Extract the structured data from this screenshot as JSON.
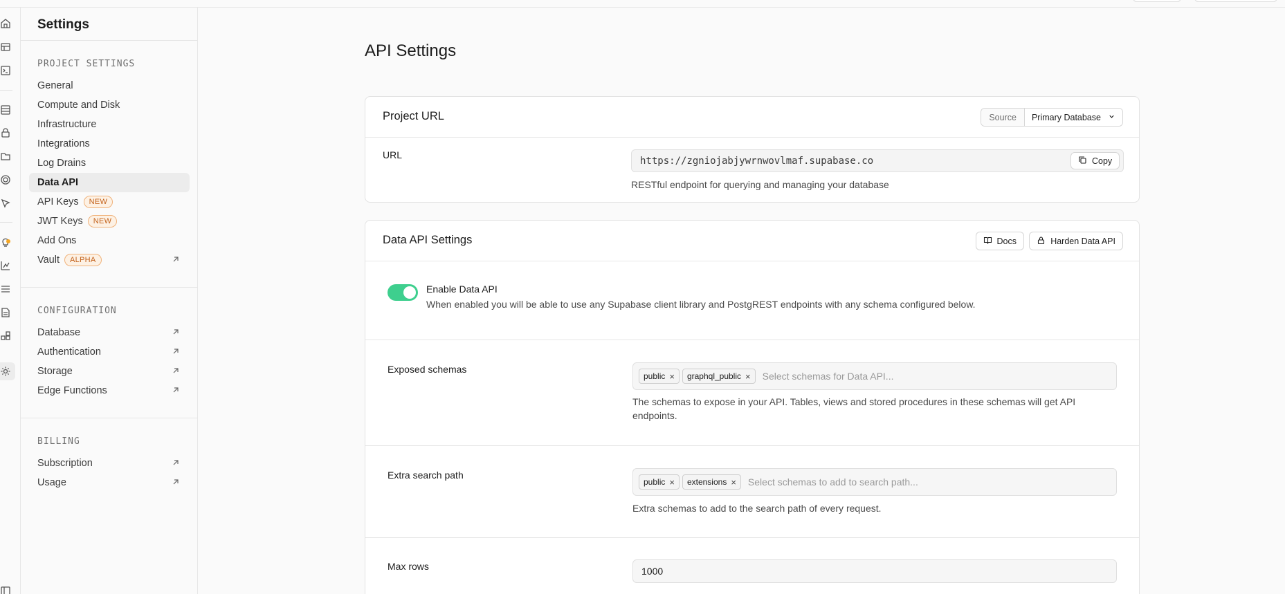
{
  "app": {
    "sidebar_title": "Settings"
  },
  "rail": {
    "icons": [
      "home-icon",
      "table-editor-icon",
      "sql-editor-icon",
      "database-icon",
      "auth-lock-icon",
      "storage-folder-icon",
      "realtime-icon",
      "edge-functions-icon",
      "advisors-bulb-icon",
      "reports-chart-icon",
      "logs-list-icon",
      "api-docs-icon",
      "integrations-icon",
      "settings-gear-icon",
      "collapse-panel-icon"
    ],
    "advisor_dot_color": "#f5a623"
  },
  "sidebar": {
    "project_settings": {
      "heading": "PROJECT SETTINGS",
      "items": [
        {
          "label": "General"
        },
        {
          "label": "Compute and Disk"
        },
        {
          "label": "Infrastructure"
        },
        {
          "label": "Integrations"
        },
        {
          "label": "Log Drains"
        },
        {
          "label": "Data API",
          "active": true
        },
        {
          "label": "API Keys",
          "badge": "NEW"
        },
        {
          "label": "JWT Keys",
          "badge": "NEW"
        },
        {
          "label": "Add Ons"
        },
        {
          "label": "Vault",
          "badge": "ALPHA",
          "external": true
        }
      ]
    },
    "configuration": {
      "heading": "CONFIGURATION",
      "items": [
        {
          "label": "Database",
          "external": true
        },
        {
          "label": "Authentication",
          "external": true
        },
        {
          "label": "Storage",
          "external": true
        },
        {
          "label": "Edge Functions",
          "external": true
        }
      ]
    },
    "billing": {
      "heading": "BILLING",
      "items": [
        {
          "label": "Subscription",
          "external": true
        },
        {
          "label": "Usage",
          "external": true
        }
      ]
    }
  },
  "main": {
    "title": "API Settings",
    "project_url": {
      "title": "Project URL",
      "source_label": "Source",
      "source_value": "Primary Database",
      "url_label": "URL",
      "url_value": "https://zgniojabjywrnwovlmaf.supabase.co",
      "copy_label": "Copy",
      "url_help": "RESTful endpoint for querying and managing your database"
    },
    "data_api": {
      "title": "Data API Settings",
      "docs_label": "Docs",
      "harden_label": "Harden Data API",
      "enable_label": "Enable Data API",
      "enable_on": true,
      "enable_desc": "When enabled you will be able to use any Supabase client library and PostgREST endpoints with any schema configured below.",
      "exposed_label": "Exposed schemas",
      "exposed_chips": [
        "public",
        "graphql_public"
      ],
      "exposed_placeholder": "Select schemas for Data API...",
      "exposed_help": "The schemas to expose in your API. Tables, views and stored procedures in these schemas will get API endpoints.",
      "extra_label": "Extra search path",
      "extra_chips": [
        "public",
        "extensions"
      ],
      "extra_placeholder": "Select schemas to add to search path...",
      "extra_help": "Extra schemas to add to the search path of every request.",
      "maxrows_label": "Max rows",
      "maxrows_value": "1000"
    },
    "colors": {
      "accent_green": "#3ecf8e",
      "badge_orange": "#c3621b"
    }
  }
}
